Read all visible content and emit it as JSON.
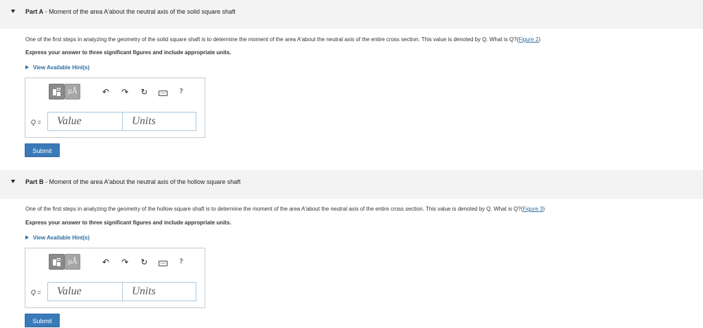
{
  "partA": {
    "letter": "Part A",
    "title": " - Moment of the area A′about the neutral axis of the solid square shaft",
    "question": "One of the first steps in analyzing the geometry of the solid square shaft is to determine the moment of the area A′about the neutral axis of the entire cross section. This value is denoted by Q. What is Q?(",
    "figure_link": "Figure 2",
    "question_end": ")",
    "instruction": "Express your answer to three significant figures and include appropriate units.",
    "hint": "View Available Hint(s)",
    "q_symbol": "Q",
    "equals": " =",
    "value_placeholder": "Value",
    "units_placeholder": "Units",
    "submit": "Submit"
  },
  "partB": {
    "letter": "Part B",
    "title": " - Moment of the area A′about the neutral axis of the hollow square shaft",
    "question": "One of the first steps in analyzing the geometry of the hollow square shaft is to determine the moment of the area A′about the neutral axis of the entire cross section. This value is denoted by Q. What is Q?(",
    "figure_link": "Figure 3",
    "question_end": ")",
    "instruction": "Express your answer to three significant figures and include appropriate units.",
    "hint": "View Available Hint(s)",
    "q_symbol": "Q",
    "equals": " =",
    "value_placeholder": "Value",
    "units_placeholder": "Units",
    "submit": "Submit"
  },
  "toolbar": {
    "units_label": "μÅ",
    "undo_glyph": "↶",
    "redo_glyph": "↷",
    "reset_glyph": "↻",
    "help_glyph": "?",
    "icons": [
      "templates-icon",
      "units-icon",
      "undo-icon",
      "redo-icon",
      "reset-icon",
      "keyboard-icon",
      "help-icon"
    ]
  },
  "colors": {
    "link": "#2a6ca0",
    "submit": "#3b7ab8",
    "header_bg": "#f3f3f3"
  }
}
